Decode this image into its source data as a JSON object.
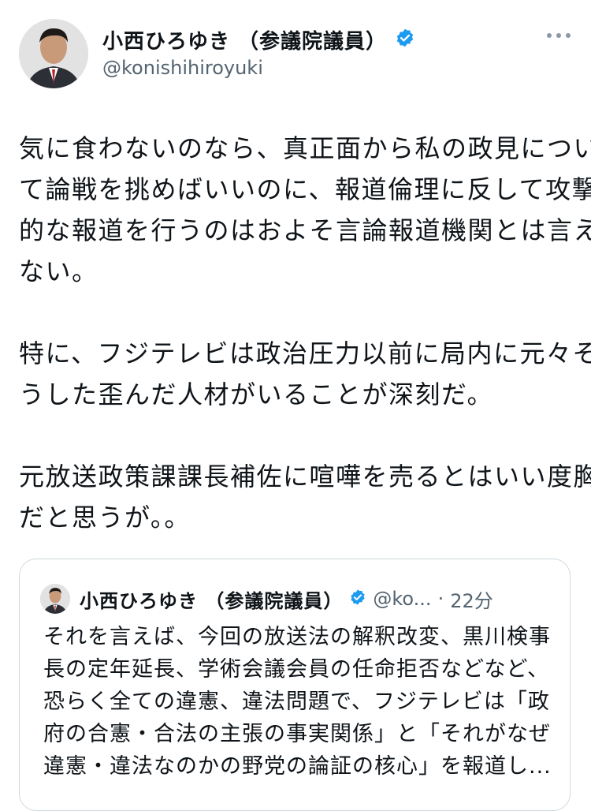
{
  "author": {
    "name": "小西ひろゆき （参議院議員）",
    "handle": "@konishihiroyuki",
    "verified_color": "#1d9bf0"
  },
  "tweet_lines": [
    "気に食わないのなら、真正面から私の政見につい",
    "て論戦を挑めばいいのに、報道倫理に反して攻撃",
    "的な報道を行うのはおよそ言論報道機関とは言え",
    "ない。",
    "",
    "特に、フジテレビは政治圧力以前に局内に元々そ",
    "うした歪んだ人材がいることが深刻だ。",
    "",
    "元放送政策課課長補佐に喧嘩を売るとはいい度胸",
    "だと思うが。。"
  ],
  "quoted": {
    "name": "小西ひろゆき （参議院議員）",
    "handle_truncated": "@ko...",
    "separator": "·",
    "time": "22分",
    "lines": [
      "それを言えば、今回の放送法の解釈改変、黒川検事",
      "長の定年延長、学術会議会員の任命拒否などなど、",
      "恐らく全ての違憲、違法問題で、フジテレビは「政",
      "府の合憲・合法の主張の事実関係」と「それがなぜ",
      "違憲・違法なのかの野党の論証の核心」を報道し..."
    ]
  }
}
